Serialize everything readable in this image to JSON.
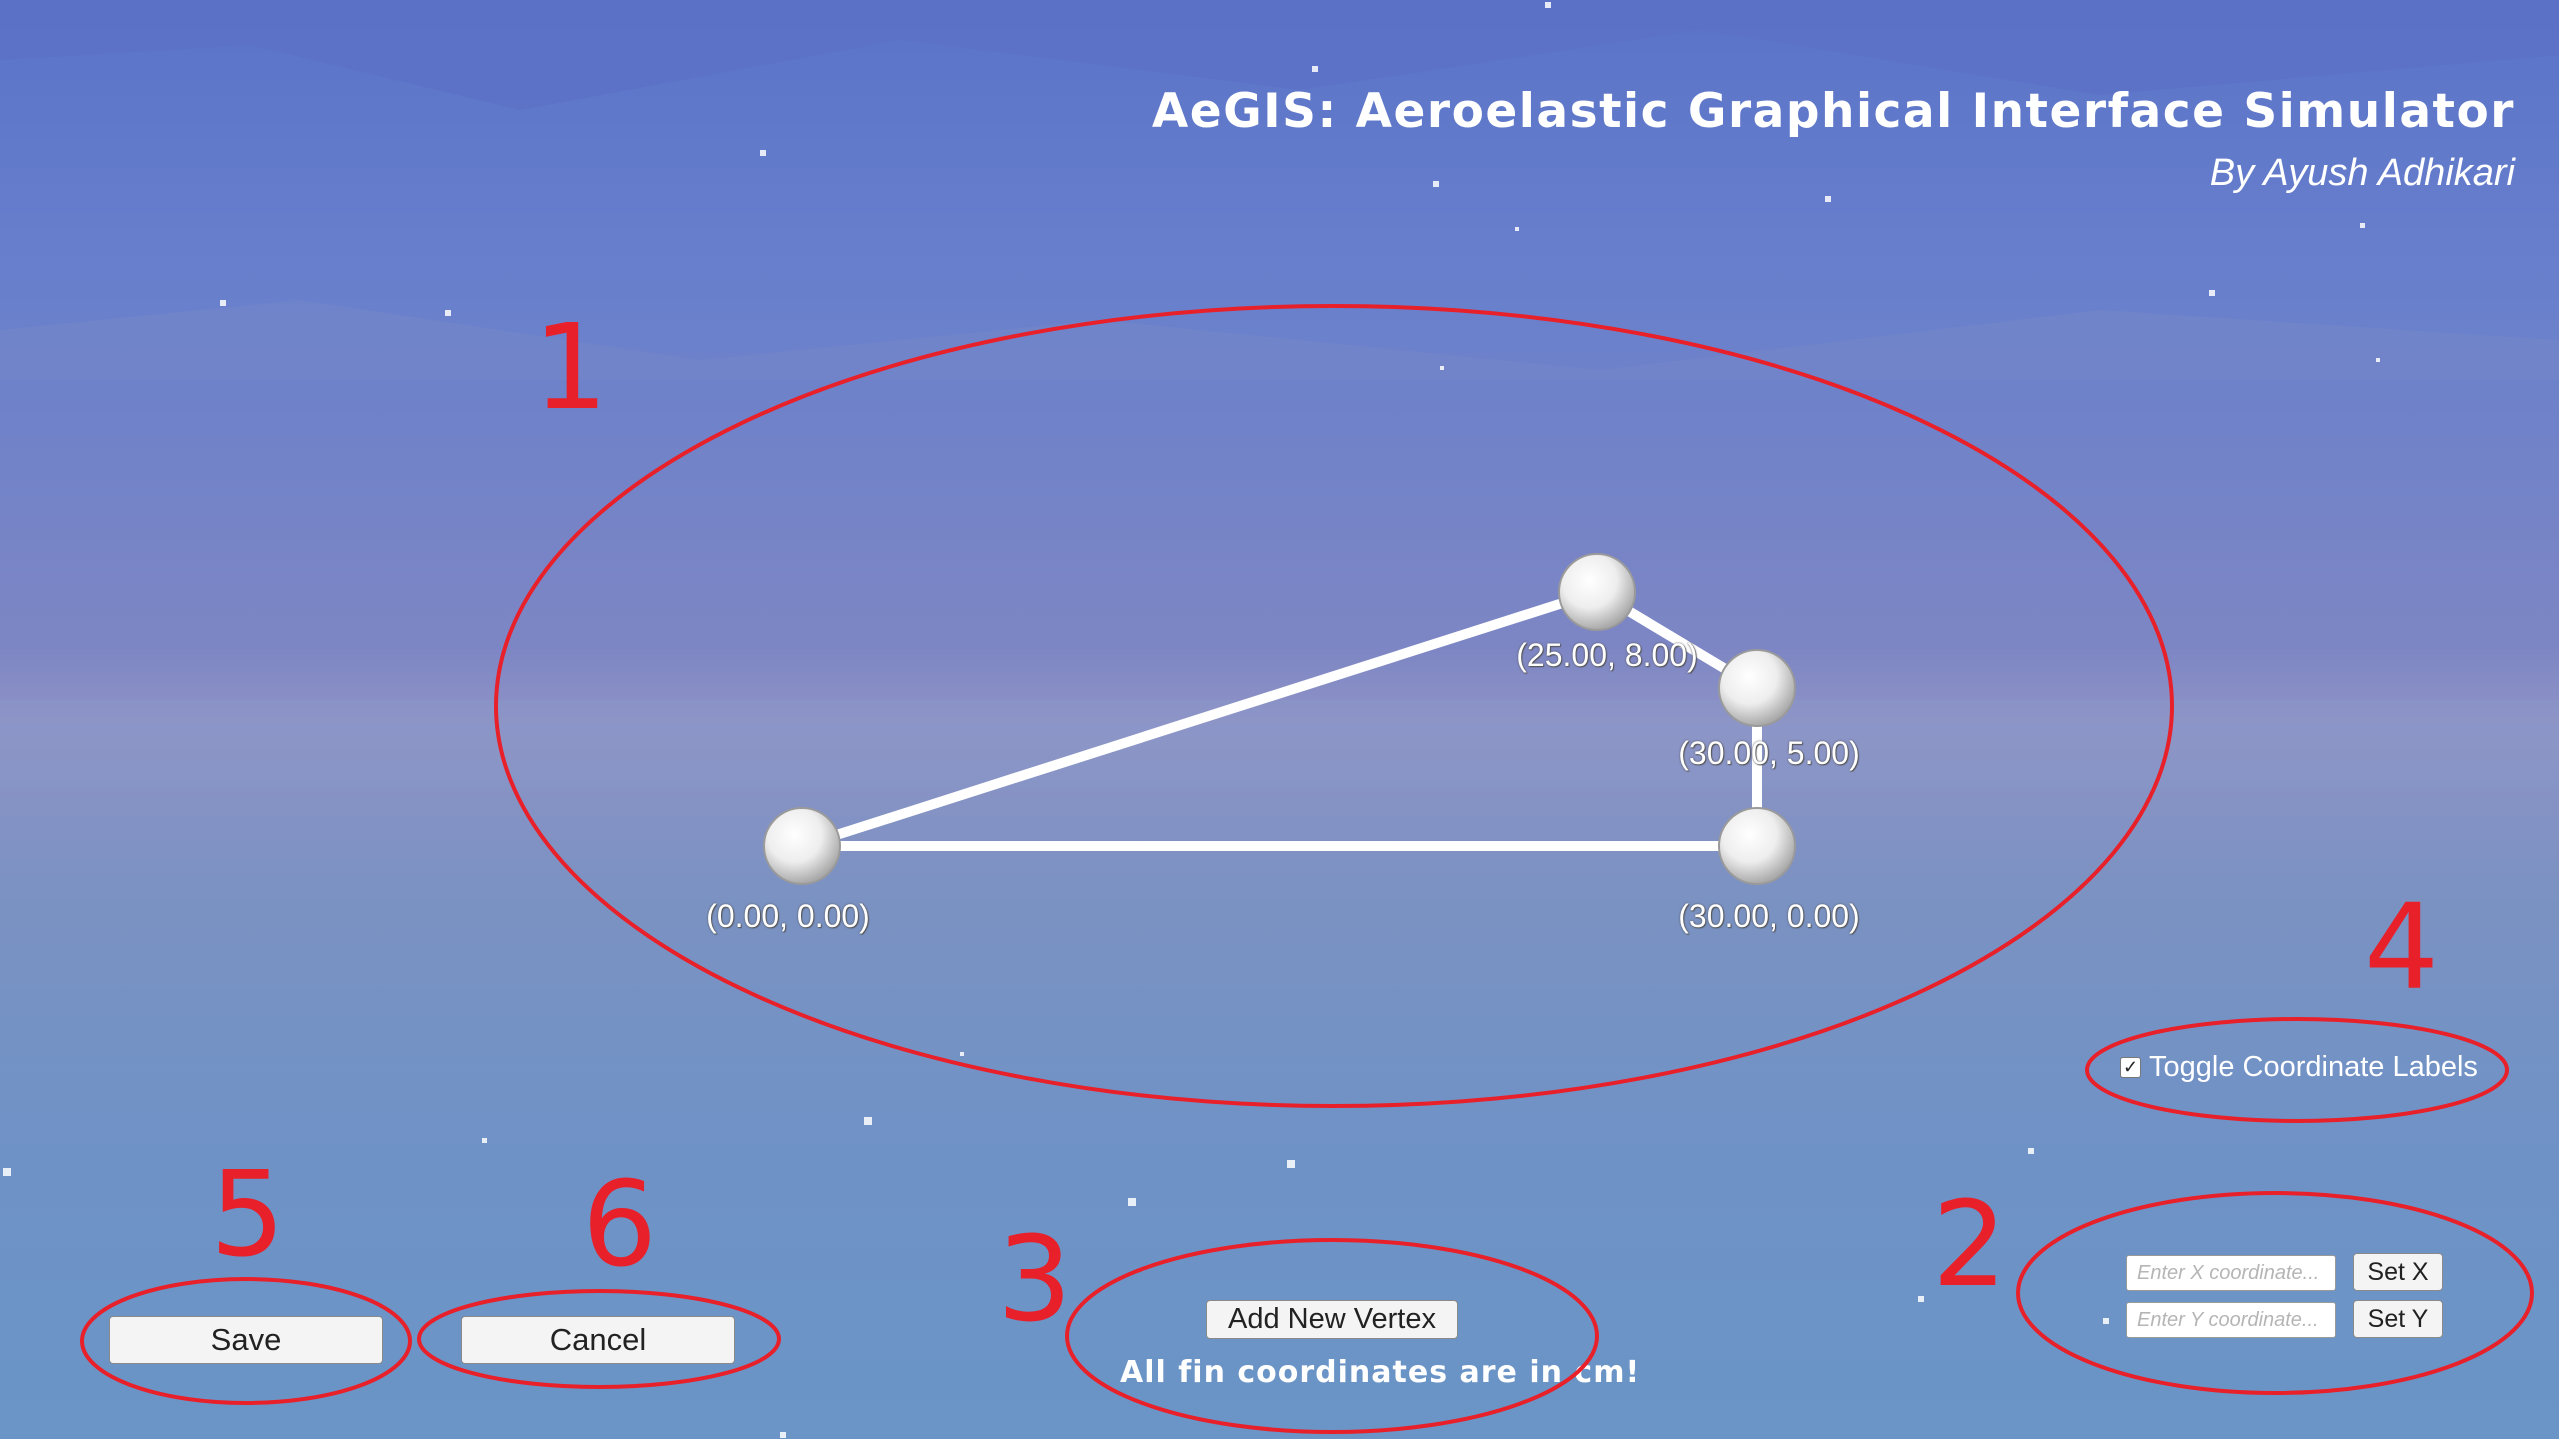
{
  "header": {
    "title": "AeGIS: Aeroelastic Graphical Interface Simulator",
    "subtitle": "By Ayush Adhikari"
  },
  "fin_editor": {
    "vertices": [
      {
        "label": "(0.00, 0.00)"
      },
      {
        "label": "(25.00, 8.00)"
      },
      {
        "label": "(30.00, 5.00)"
      },
      {
        "label": "(30.00, 0.00)"
      }
    ]
  },
  "controls": {
    "toggle_label": "Toggle Coordinate Labels",
    "toggle_checked": true,
    "x_placeholder": "Enter X coordinate...",
    "y_placeholder": "Enter Y coordinate...",
    "set_x_label": "Set X",
    "set_y_label": "Set Y",
    "add_vertex_label": "Add New Vertex",
    "units_note": "All fin coordinates are in cm!",
    "save_label": "Save",
    "cancel_label": "Cancel"
  },
  "annotations": {
    "m1": "1",
    "m2": "2",
    "m3": "3",
    "m4": "4",
    "m5": "5",
    "m6": "6",
    "color": "#e8202a"
  }
}
